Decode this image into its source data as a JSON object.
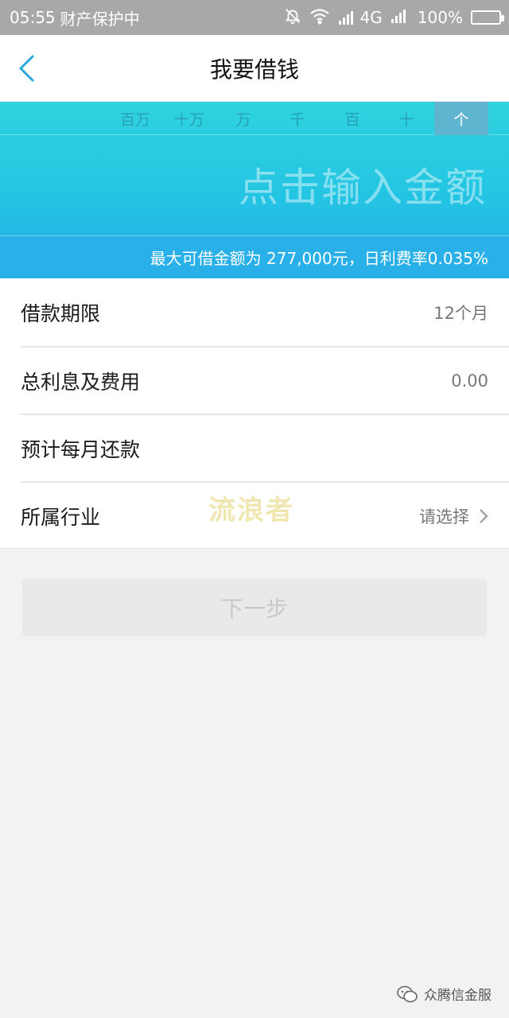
{
  "status_bar": {
    "time": "05:55",
    "notice": "财产保护中",
    "network": "4G",
    "battery": "100%"
  },
  "nav": {
    "title": "我要借钱"
  },
  "amount": {
    "digits": [
      "百万",
      "十万",
      "万",
      "千",
      "百",
      "十",
      "个"
    ],
    "active_digit": "个",
    "placeholder": "点击输入金额",
    "info": "最大可借金额为 277,000元，日利费率0.035%"
  },
  "form": {
    "term_label": "借款期限",
    "term_value": "12个月",
    "interest_label": "总利息及费用",
    "interest_value": "0.00",
    "monthly_label": "预计每月还款",
    "industry_label": "所属行业",
    "industry_value": "请选择"
  },
  "watermark": "流浪者",
  "next_button": "下一步",
  "footer_brand": "众腾信金服",
  "colors": {
    "accent": "#23c4e3",
    "info_bar": "#2ab0e8",
    "active_digit": "#5fb4d0"
  }
}
